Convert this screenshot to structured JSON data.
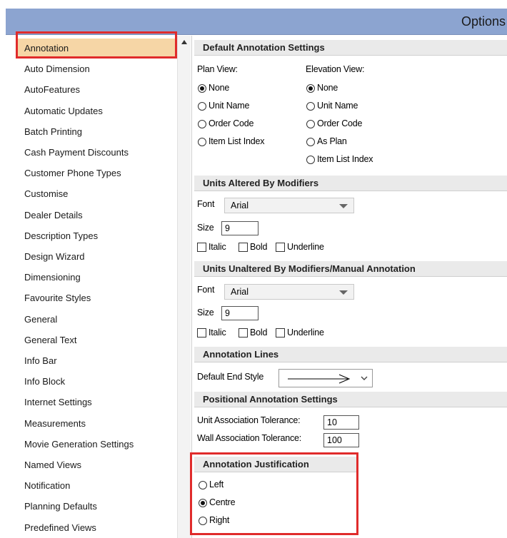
{
  "window": {
    "title": "Options"
  },
  "sidebar": {
    "items": [
      {
        "label": "Annotation",
        "selected": true
      },
      {
        "label": "Auto Dimension"
      },
      {
        "label": "AutoFeatures"
      },
      {
        "label": "Automatic Updates"
      },
      {
        "label": "Batch Printing"
      },
      {
        "label": "Cash Payment Discounts"
      },
      {
        "label": "Customer Phone Types"
      },
      {
        "label": "Customise"
      },
      {
        "label": "Dealer Details"
      },
      {
        "label": "Description Types"
      },
      {
        "label": "Design Wizard"
      },
      {
        "label": "Dimensioning"
      },
      {
        "label": "Favourite Styles"
      },
      {
        "label": "General"
      },
      {
        "label": "General Text"
      },
      {
        "label": "Info Bar"
      },
      {
        "label": "Info Block"
      },
      {
        "label": "Internet Settings"
      },
      {
        "label": "Measurements"
      },
      {
        "label": "Movie Generation Settings"
      },
      {
        "label": "Named Views"
      },
      {
        "label": "Notification"
      },
      {
        "label": "Planning Defaults"
      },
      {
        "label": "Predefined Views"
      }
    ]
  },
  "default_annotation": {
    "header": "Default Annotation Settings",
    "plan_label": "Plan View:",
    "elevation_label": "Elevation View:",
    "plan_options": [
      "None",
      "Unit Name",
      "Order Code",
      "Item List Index"
    ],
    "plan_selected": "None",
    "elevation_options": [
      "None",
      "Unit Name",
      "Order Code",
      "As Plan",
      "Item List Index"
    ],
    "elevation_selected": "None"
  },
  "units_altered": {
    "header": "Units Altered By Modifiers",
    "font_label": "Font",
    "font_value": "Arial",
    "size_label": "Size",
    "size_value": "9",
    "italic": "Italic",
    "bold": "Bold",
    "underline": "Underline"
  },
  "units_unaltered": {
    "header": "Units Unaltered By Modifiers/Manual Annotation",
    "font_label": "Font",
    "font_value": "Arial",
    "size_label": "Size",
    "size_value": "9",
    "italic": "Italic",
    "bold": "Bold",
    "underline": "Underline"
  },
  "annotation_lines": {
    "header": "Annotation Lines",
    "end_style_label": "Default End Style"
  },
  "positional": {
    "header": "Positional Annotation Settings",
    "unit_label": "Unit Association Tolerance:",
    "unit_value": "10",
    "wall_label": "Wall Association Tolerance:",
    "wall_value": "100"
  },
  "justification": {
    "header": "Annotation Justification",
    "options": [
      "Left",
      "Centre",
      "Right"
    ],
    "selected": "Centre"
  },
  "colors": {
    "title_bar": "#8ca4d0",
    "selection": "#f6d6a6",
    "highlight": "#e02b2b"
  }
}
